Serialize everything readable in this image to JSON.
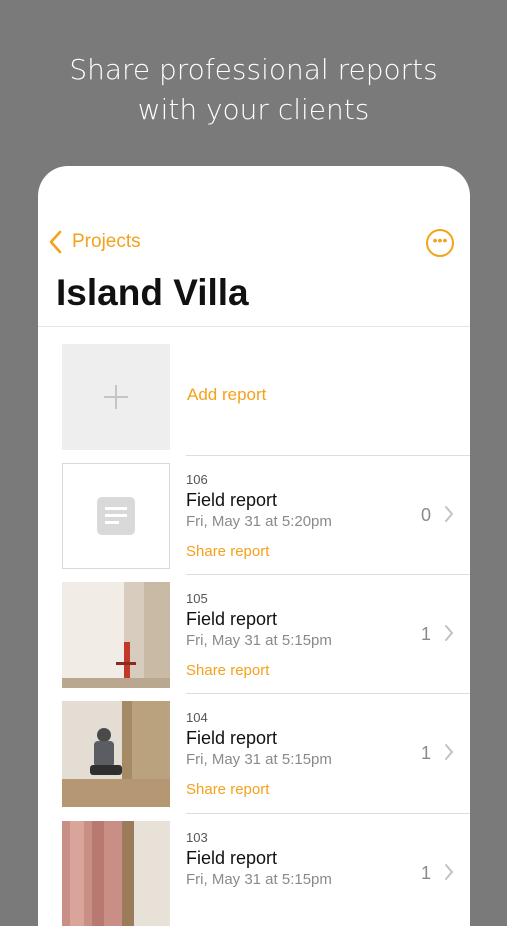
{
  "headline": {
    "line1": "Share professional reports",
    "line2": "with your clients"
  },
  "nav": {
    "back_label": "Projects",
    "more_icon": "ellipsis-circle-icon",
    "title": "Island Villa"
  },
  "colors": {
    "accent": "#f5a11a",
    "background": "#7a7a7a"
  },
  "add_report": {
    "label": "Add report",
    "icon": "plus-icon"
  },
  "reports": [
    {
      "number": "106",
      "title": "Field report",
      "date": "Fri, May 31 at 5:20pm",
      "share": "Share report",
      "count": "0",
      "thumb": "document-icon"
    },
    {
      "number": "105",
      "title": "Field report",
      "date": "Fri, May 31 at 5:15pm",
      "share": "Share report",
      "count": "1",
      "thumb": "photo-wall"
    },
    {
      "number": "104",
      "title": "Field report",
      "date": "Fri, May 31 at 5:15pm",
      "share": "Share report",
      "count": "1",
      "thumb": "photo-worker"
    },
    {
      "number": "103",
      "title": "Field report",
      "date": "Fri, May 31 at 5:15pm",
      "share": "",
      "count": "1",
      "thumb": "photo-insulation"
    }
  ]
}
